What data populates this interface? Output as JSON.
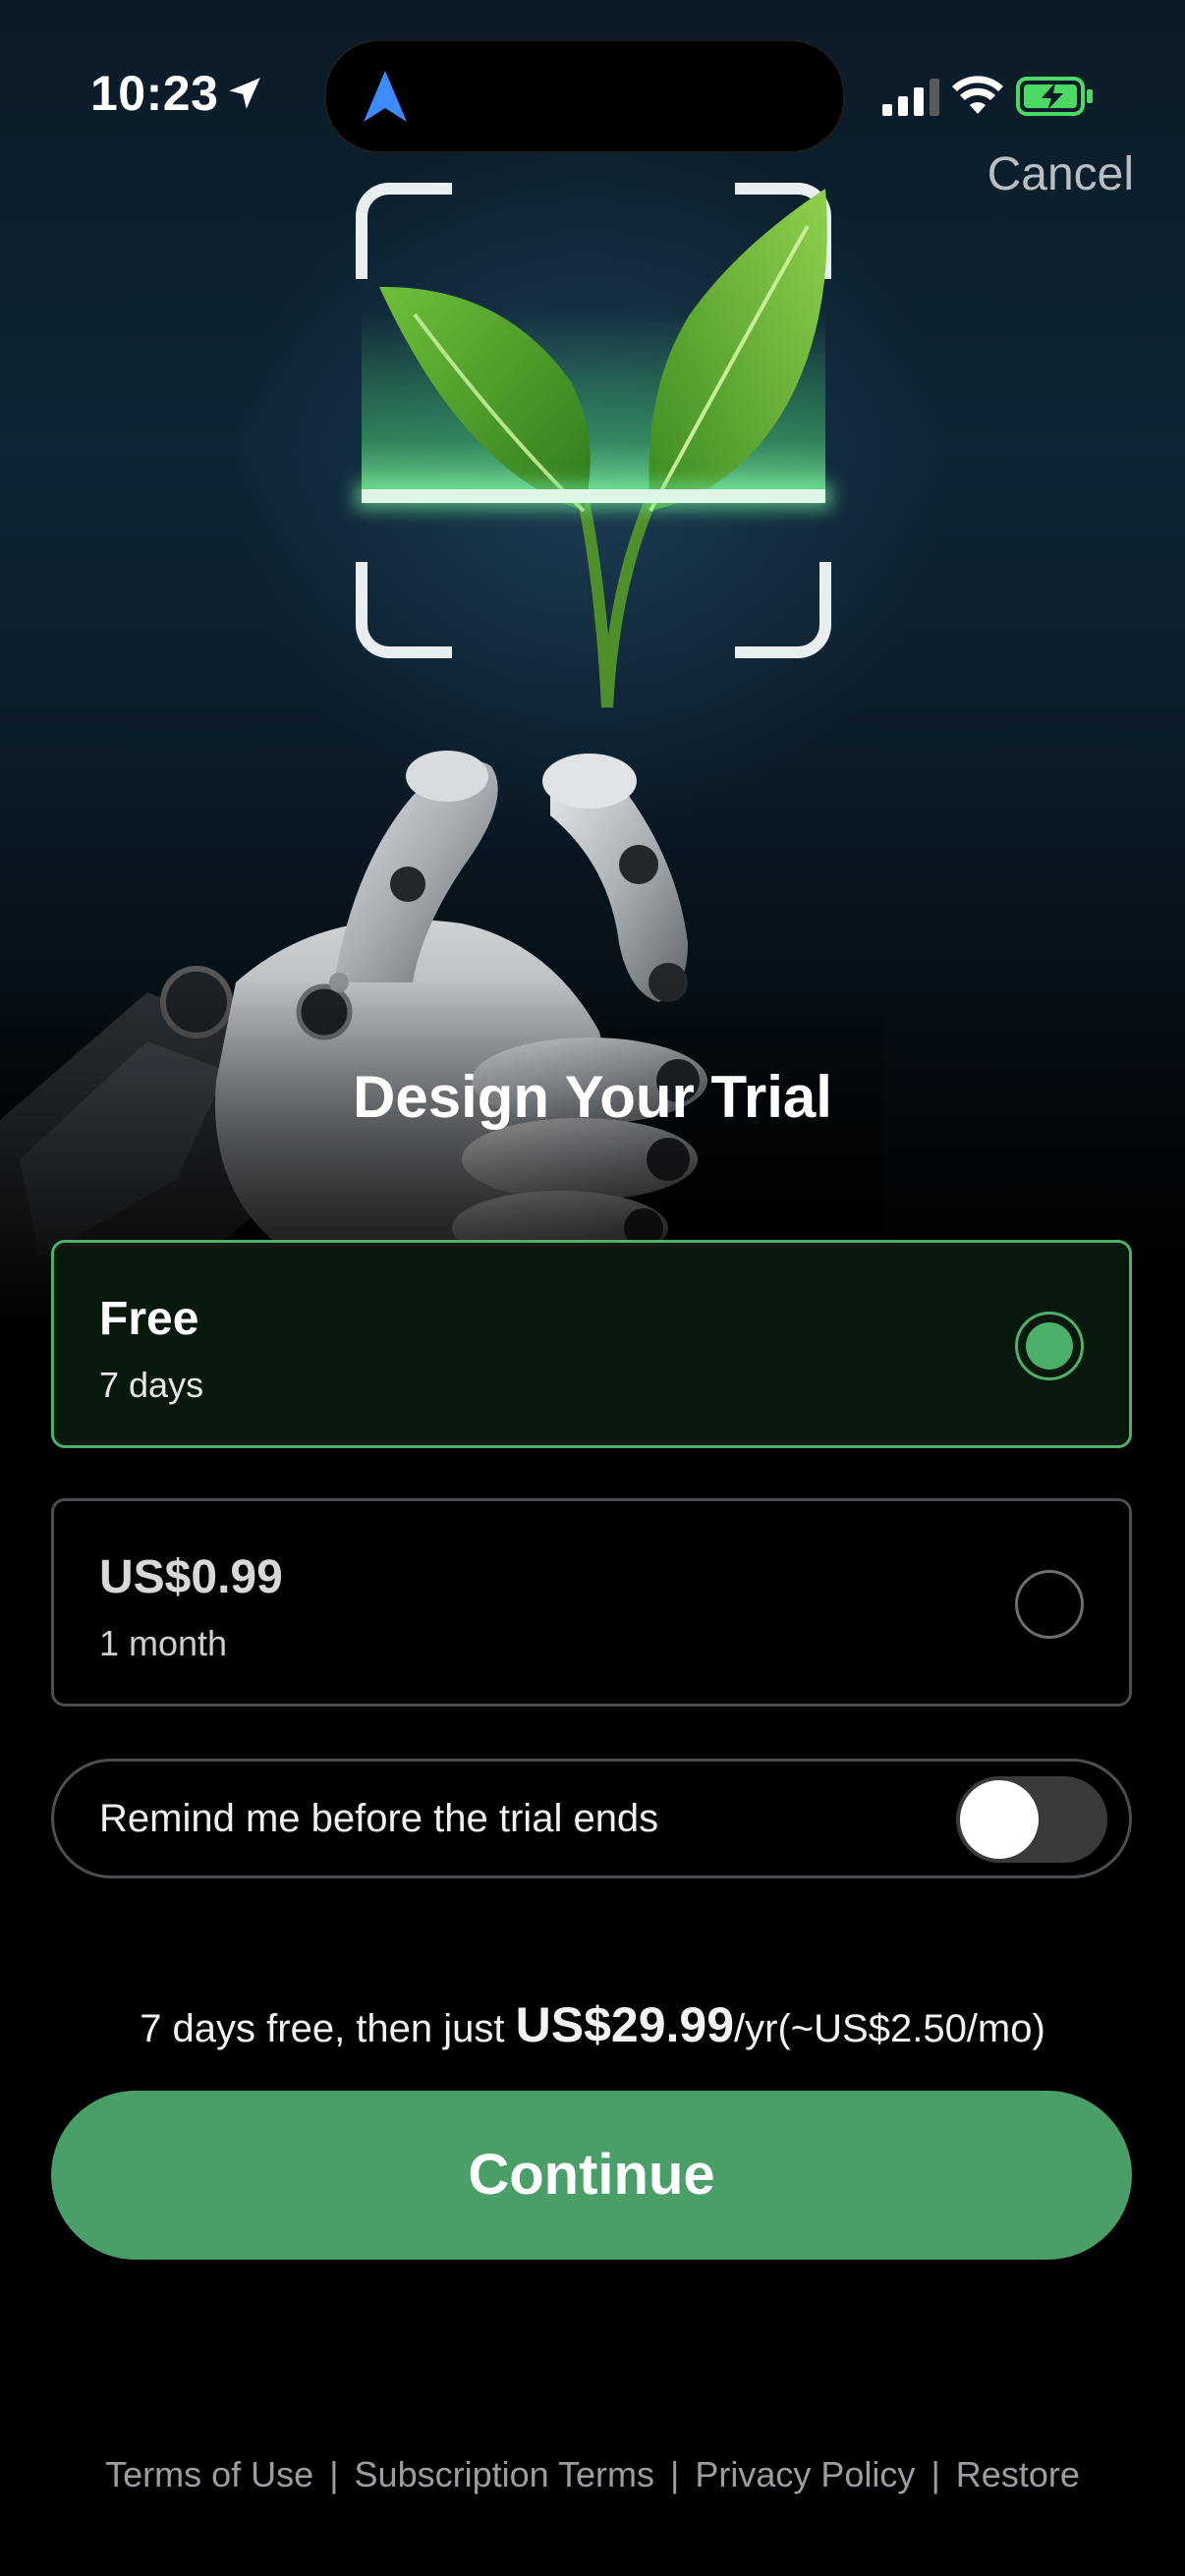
{
  "status_bar": {
    "time": "10:23",
    "icons": [
      "location-arrow-icon",
      "navigation-icon",
      "cellular-signal-icon",
      "wifi-icon",
      "battery-charging-icon"
    ]
  },
  "header": {
    "cancel_label": "Cancel"
  },
  "hero": {
    "image": "robot-hand-holding-plant-scan",
    "title": "Design Your Trial"
  },
  "plans": [
    {
      "title": "Free",
      "duration": "7 days",
      "selected": true
    },
    {
      "title": "US$0.99",
      "duration": "1 month",
      "selected": false
    }
  ],
  "reminder": {
    "label": "Remind me before the trial ends",
    "enabled": false
  },
  "pricing": {
    "prefix": "7 days free, then just ",
    "price": "US$29.99",
    "suffix": "/yr(~US$2.50/mo)"
  },
  "continue_label": "Continue",
  "footer": {
    "links": [
      "Terms of Use",
      "Subscription Terms",
      "Privacy Policy",
      "Restore"
    ],
    "separator": "|"
  },
  "colors": {
    "accent": "#4a9f68",
    "selected_border": "#4caf6a",
    "background": "#000000"
  }
}
